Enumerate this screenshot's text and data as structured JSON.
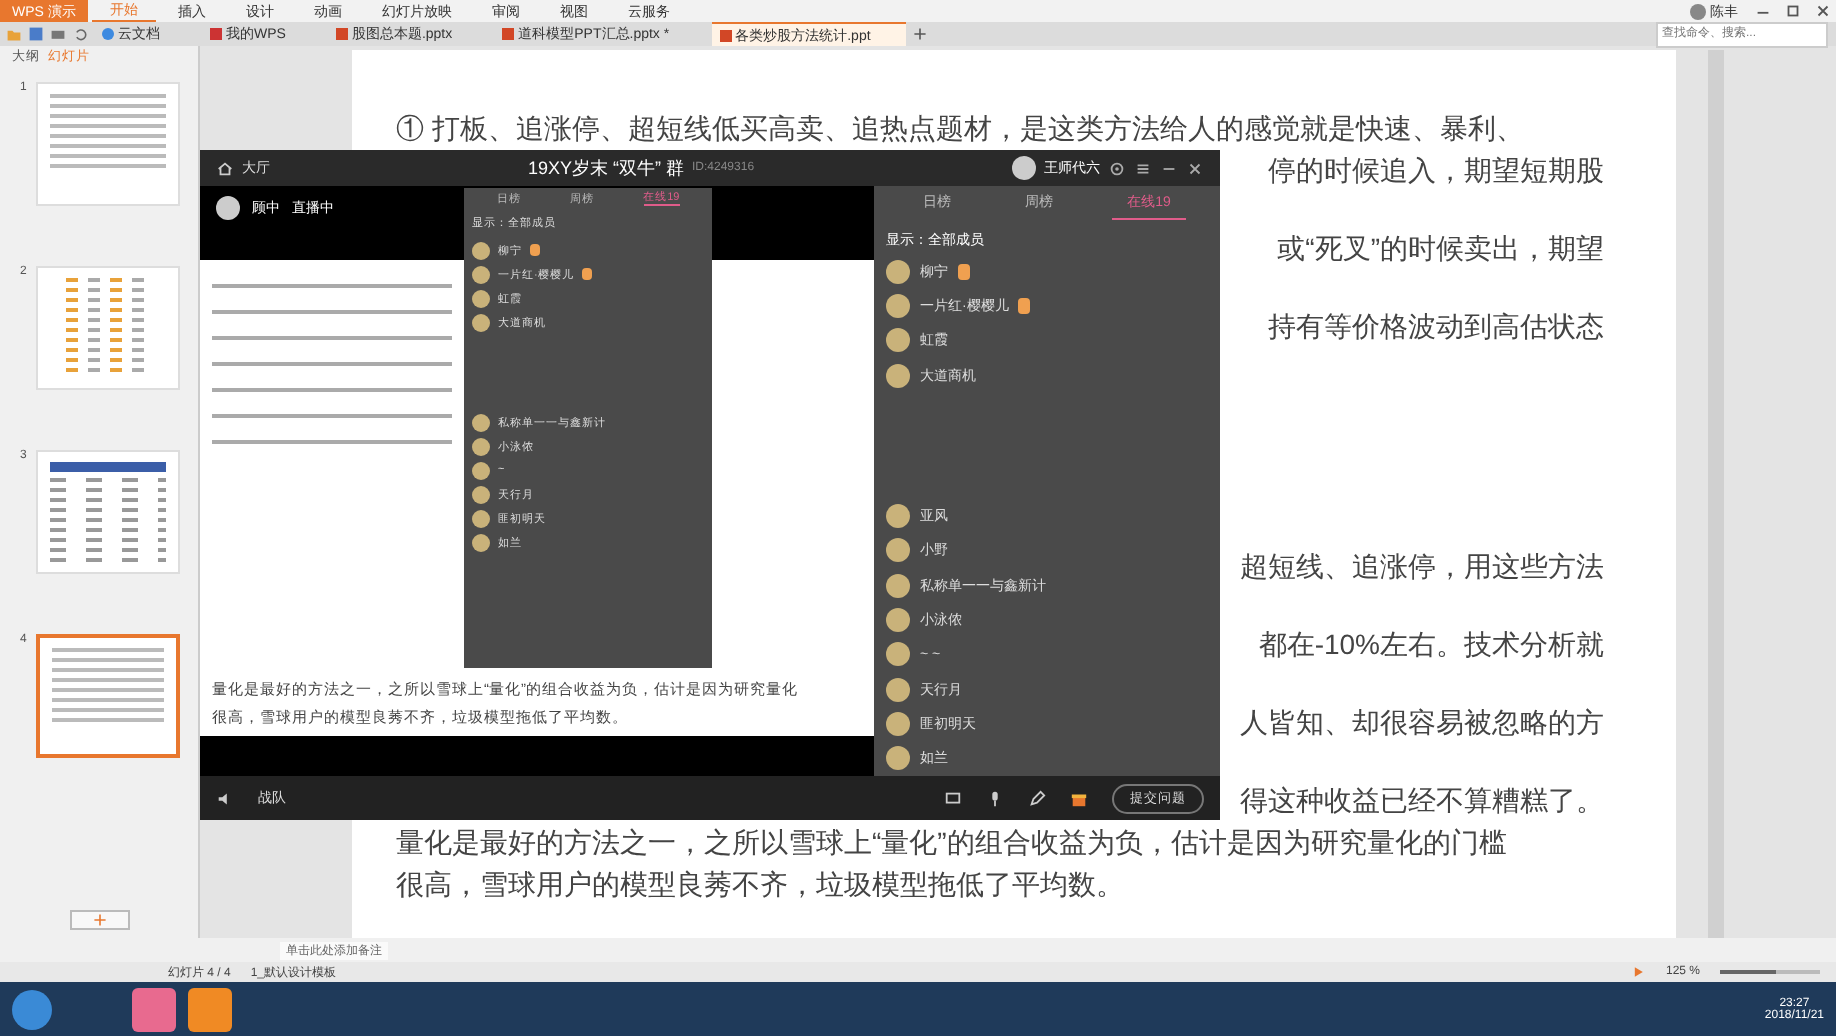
{
  "app_menu": "WPS 演示",
  "ribbon_tabs": [
    {
      "label": "开始",
      "selected": true
    },
    {
      "label": "插入",
      "selected": false
    },
    {
      "label": "设计",
      "selected": false
    },
    {
      "label": "动画",
      "selected": false
    },
    {
      "label": "幻灯片放映",
      "selected": false
    },
    {
      "label": "审阅",
      "selected": false
    },
    {
      "label": "视图",
      "selected": false
    },
    {
      "label": "云服务",
      "selected": false
    }
  ],
  "user": "陈丰",
  "doc_tabs": [
    {
      "label": "云文档",
      "kind": "cloud",
      "selected": false
    },
    {
      "label": "我的WPS",
      "kind": "home",
      "selected": false
    },
    {
      "label": "股图总本题.pptx",
      "kind": "file",
      "selected": false
    },
    {
      "label": "道科模型PPT汇总.pptx *",
      "kind": "file",
      "selected": false
    },
    {
      "label": "各类炒股方法统计.ppt",
      "kind": "file",
      "selected": true
    }
  ],
  "search": {
    "placeholder": "查找命令、搜索..."
  },
  "panel_tabs": [
    {
      "label": "大纲",
      "selected": false
    },
    {
      "label": "幻灯片",
      "selected": true
    }
  ],
  "thumbnails": [
    {
      "number": "1",
      "kind": "text",
      "selected": false
    },
    {
      "number": "2",
      "kind": "sheet",
      "selected": false
    },
    {
      "number": "3",
      "kind": "table",
      "selected": false
    },
    {
      "number": "4",
      "kind": "text",
      "selected": true
    }
  ],
  "slide": {
    "top_paragraphs": [
      [
        {
          "text": "① 打板、追涨停、超短线低买高卖、追热点题材，是这类方法给人的感觉就是快速、暴利、",
          "kind": "full"
        },
        {
          "text": "停的时候追入，期望短期股",
          "kind": "tail"
        }
      ],
      [
        {
          "text": "或“死叉”的时候卖出，期望",
          "kind": "tail"
        }
      ],
      [
        {
          "text": "持有等价格波动到高估状态",
          "kind": "tail"
        }
      ]
    ],
    "bottom_paragraphs": [
      [
        {
          "text": "超短线、追涨停，用这些方法",
          "kind": "tail"
        }
      ],
      [
        {
          "text": "都在-10%左右。技术分析就",
          "kind": "tail"
        }
      ],
      [
        {
          "text": "人皆知、却很容易被忽略的方",
          "kind": "tail"
        }
      ],
      [
        {
          "text": "得这种收益已经不算糟糕了。",
          "kind": "tail"
        },
        {
          "text": "量化是最好的方法之一，之所以雪球上“量化”的组合收益为负，估计是因为研究量化的门槛",
          "kind": "full"
        },
        {
          "text": "很高，雪球用户的模型良莠不齐，垃圾模型拖低了平均数。",
          "kind": "full"
        }
      ]
    ]
  },
  "live_window": {
    "lobby": "大厅",
    "title": "19XY岁末 “双牛” 群",
    "room_id": "ID:4249316",
    "host": "王师代六",
    "anchor": "顾中",
    "live_state": "直播中",
    "share_lines": [
      "量化是最好的方法之一，之所以雪球上“量化”的组合收益为负，估计是因为研究量化",
      "很高，雪球用户的模型良莠不齐，垃圾模型拖低了平均数。"
    ],
    "nested_panel": {
      "tabs": [
        {
          "label": "日榜",
          "selected": false
        },
        {
          "label": "周榜",
          "selected": false
        },
        {
          "label": "在线19",
          "selected": true
        }
      ],
      "filter": "显示：全部成员",
      "members": [
        {
          "name": "柳宁",
          "badge": true
        },
        {
          "name": "一片红·樱樱儿",
          "badge": true
        },
        {
          "name": "虹霞",
          "badge": false
        },
        {
          "name": "大道商机",
          "badge": false
        }
      ],
      "members_lower": [
        {
          "name": "私称单一一与鑫新计",
          "badge": false
        },
        {
          "name": "小泳侬",
          "badge": false
        },
        {
          "name": "~",
          "badge": false
        },
        {
          "name": "天行月",
          "badge": false
        },
        {
          "name": "匪初明天",
          "badge": false
        },
        {
          "name": "如兰",
          "badge": false
        }
      ]
    },
    "team_label": "战队",
    "ask_button": "提交问题",
    "panel": {
      "tabs": [
        {
          "label": "日榜",
          "selected": false
        },
        {
          "label": "周榜",
          "selected": false
        },
        {
          "label": "在线19",
          "selected": true
        }
      ],
      "filter": "显示：全部成员",
      "members": [
        {
          "name": "柳宁",
          "badge": true
        },
        {
          "name": "一片红·樱樱儿",
          "badge": true
        },
        {
          "name": "虹霞",
          "badge": false
        },
        {
          "name": "大道商机",
          "badge": false
        }
      ],
      "members_lower": [
        {
          "name": "亚风",
          "badge": false
        },
        {
          "name": "小野",
          "badge": false
        },
        {
          "name": "私称单一一与鑫新计",
          "badge": false
        },
        {
          "name": "小泳侬",
          "badge": false
        },
        {
          "name": "~ ~",
          "badge": false
        },
        {
          "name": "天行月",
          "badge": false
        },
        {
          "name": "匪初明天",
          "badge": false
        },
        {
          "name": "如兰",
          "badge": false
        }
      ]
    }
  },
  "notes_placeholder": "单击此处添加备注",
  "status_bar": {
    "slide": "幻灯片 4 / 4",
    "template": "1_默认设计模板",
    "zoom": "125 %",
    "zoom_slider": {
      "level": 0.55
    }
  },
  "taskbar": {
    "time": "23:27",
    "date": "2018/11/21"
  }
}
